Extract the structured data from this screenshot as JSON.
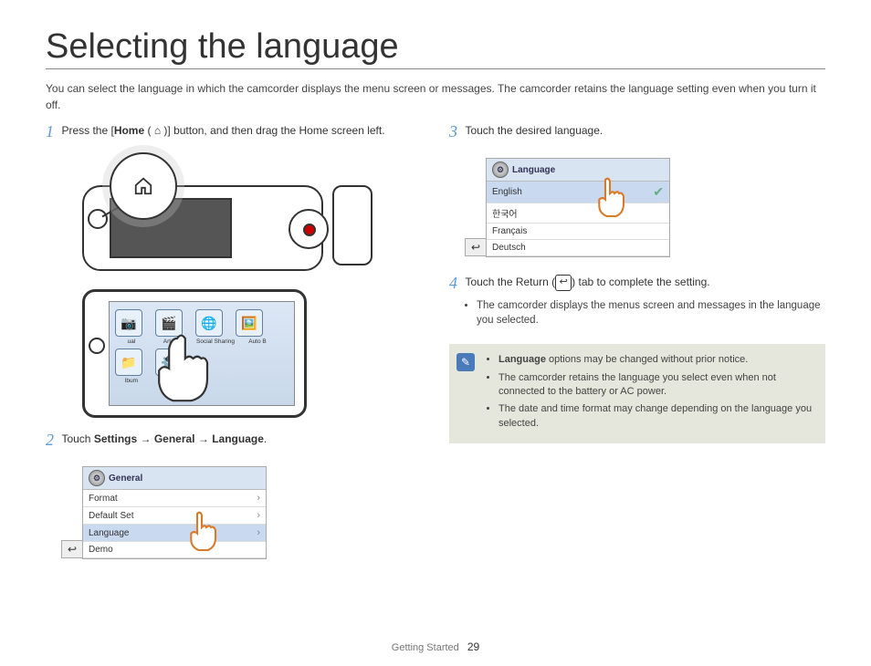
{
  "title": "Selecting the language",
  "intro": "You can select the language in which the camcorder displays the menu screen or messages. The camcorder retains the language setting even when you turn it off.",
  "steps": {
    "s1_pre": "Press the [",
    "s1_bold": "Home",
    "s1_post": " ( ⌂ )] button, and then drag the Home screen left.",
    "s2_pre": "Touch ",
    "s2_b1": "Settings",
    "s2_arrow1": " → ",
    "s2_b2": "General",
    "s2_arrow2": " → ",
    "s2_b3": "Language",
    "s2_post": ".",
    "s3": "Touch the desired language.",
    "s4_pre": "Touch the Return (",
    "s4_icon": "↩",
    "s4_post": ") tab to complete the setting.",
    "s4_bullet": "The camcorder displays the menus screen and messages in the language you selected."
  },
  "homescreen": {
    "icons": [
      "ual",
      "Art Film",
      "Social Sharing",
      "Auto B"
    ],
    "icons2": [
      "lbum",
      "Settings"
    ]
  },
  "general_menu": {
    "header": "General",
    "items": [
      "Format",
      "Default Set",
      "Language",
      "Demo"
    ],
    "selected_index": 2
  },
  "language_menu": {
    "header": "Language",
    "items": [
      "English",
      "한국어",
      "Français",
      "Deutsch"
    ],
    "selected_index": 0
  },
  "notes": [
    "Language options may be changed without prior notice.",
    "The camcorder retains the language you select even when not connected to the battery or AC power.",
    "The date and time format may change depending on the language you selected."
  ],
  "notes_bold": "Language",
  "footer_section": "Getting Started",
  "footer_page": "29"
}
